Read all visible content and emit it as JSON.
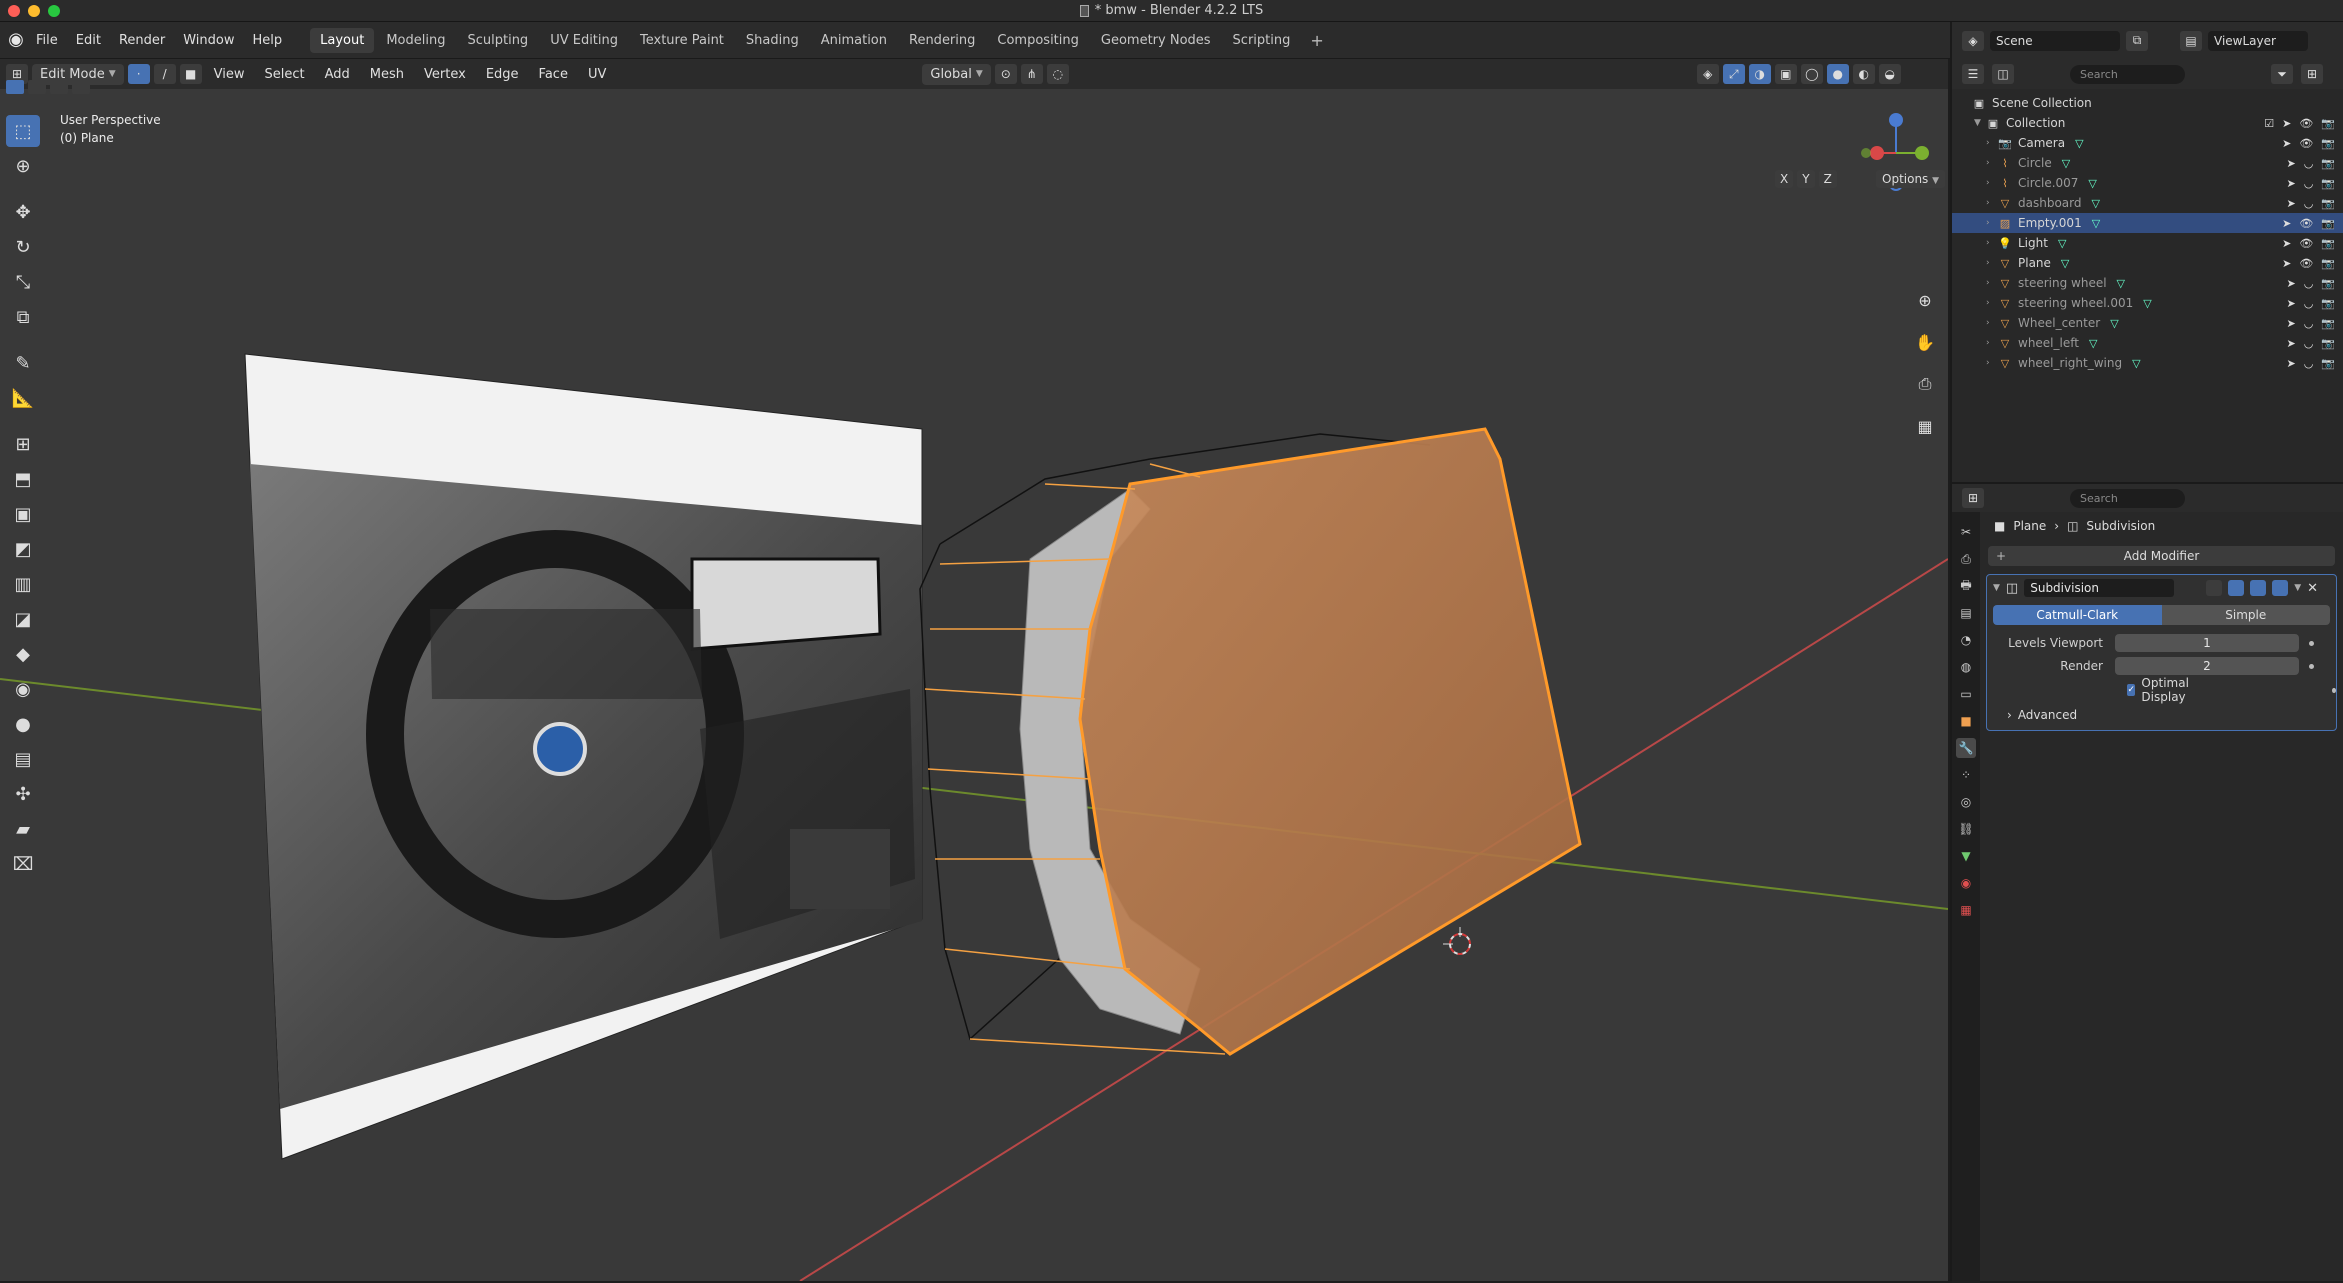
{
  "window": {
    "title": "* bmw - Blender 4.2.2 LTS"
  },
  "menu": {
    "items": [
      "File",
      "Edit",
      "Render",
      "Window",
      "Help"
    ]
  },
  "workspaces": [
    "Layout",
    "Modeling",
    "Sculpting",
    "UV Editing",
    "Texture Paint",
    "Shading",
    "Animation",
    "Rendering",
    "Compositing",
    "Geometry Nodes",
    "Scripting"
  ],
  "workspace_active": "Layout",
  "viewport_header": {
    "mode": "Edit Mode",
    "menus": [
      "View",
      "Select",
      "Add",
      "Mesh",
      "Vertex",
      "Edge",
      "Face",
      "UV"
    ],
    "orientation": "Global"
  },
  "viewport": {
    "perspective": "User Perspective",
    "object": "(0) Plane",
    "axes": {
      "x": "X",
      "y": "Y",
      "z": "Z"
    },
    "options_label": "Options",
    "colors": {
      "background": "#393939",
      "selection": "#f5a142",
      "grid_x": "#c04040",
      "grid_y": "#6a8f2a"
    }
  },
  "outliner": {
    "scene": "Scene",
    "view_layer": "ViewLayer",
    "search_placeholder": "Search",
    "root": "Scene Collection",
    "collection": "Collection",
    "items": [
      {
        "name": "Camera",
        "icon": "camera-icon",
        "selected": false,
        "dim": false
      },
      {
        "name": "Circle",
        "icon": "curve-icon",
        "selected": false,
        "dim": true
      },
      {
        "name": "Circle.007",
        "icon": "curve-icon",
        "selected": false,
        "dim": true
      },
      {
        "name": "dashboard",
        "icon": "mesh-icon",
        "selected": false,
        "dim": true
      },
      {
        "name": "Empty.001",
        "icon": "image-empty-icon",
        "selected": true,
        "dim": false
      },
      {
        "name": "Light",
        "icon": "light-icon",
        "selected": false,
        "dim": false
      },
      {
        "name": "Plane",
        "icon": "mesh-icon",
        "selected": false,
        "dim": false
      },
      {
        "name": "steering wheel",
        "icon": "mesh-icon",
        "selected": false,
        "dim": true
      },
      {
        "name": "steering wheel.001",
        "icon": "mesh-icon",
        "selected": false,
        "dim": true
      },
      {
        "name": "Wheel_center",
        "icon": "mesh-icon",
        "selected": false,
        "dim": true
      },
      {
        "name": "wheel_left",
        "icon": "mesh-icon",
        "selected": false,
        "dim": true
      },
      {
        "name": "wheel_right_wing",
        "icon": "mesh-icon",
        "selected": false,
        "dim": true
      }
    ]
  },
  "properties": {
    "search_placeholder": "Search",
    "breadcrumb": {
      "object": "Plane",
      "modifier": "Subdivision"
    },
    "add_modifier": "Add Modifier",
    "modifier": {
      "name": "Subdivision",
      "type_options": [
        "Catmull-Clark",
        "Simple"
      ],
      "type_selected": "Catmull-Clark",
      "levels_viewport_label": "Levels Viewport",
      "levels_viewport": "1",
      "render_label": "Render",
      "render": "2",
      "optimal_display_label": "Optimal Display",
      "advanced_label": "Advanced"
    }
  }
}
